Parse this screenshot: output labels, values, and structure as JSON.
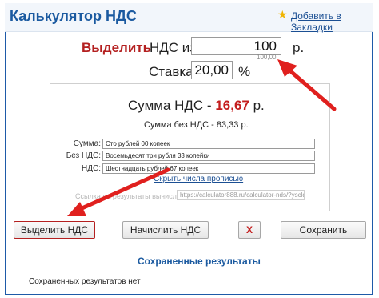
{
  "header": {
    "title": "Калькулятор НДС",
    "bookmark_label": "Добавить в Закладки"
  },
  "form": {
    "mode_label": "Выделить",
    "vat_from_label": "НДС из",
    "amount_value": "100",
    "amount_hint": "100,00",
    "currency_label": "р.",
    "rate_label": "Ставка",
    "rate_value": "20,00",
    "percent_label": "%"
  },
  "result": {
    "vat_prefix": "Сумма НДС - ",
    "vat_value": "16,67",
    "vat_suffix": " р.",
    "net_line": "Сумма без НДС - 83,33 р.",
    "rows": [
      {
        "label": "Сумма:",
        "value": "Сто рублей 00 копеек"
      },
      {
        "label": "Без НДС:",
        "value": "Восемьдесят три рубля 33 копейки"
      },
      {
        "label": "НДС:",
        "value": "Шестнадцать рублей 67 копеек"
      }
    ],
    "hide_words_link": "Скрыть числа прописью",
    "link_label": "Ссылка на результаты вычислений:",
    "link_value": "https://calculator888.ru/calculator-nds/?yscld=c"
  },
  "buttons": {
    "extract_vat": "Выделить НДС",
    "add_vat": "Начислить НДС",
    "clear": "X",
    "save": "Сохранить"
  },
  "saved": {
    "title": "Сохраненные результаты",
    "empty_text": "Сохраненных результатов нет"
  },
  "colors": {
    "accent_red": "#c41e1e",
    "brand_blue": "#1b5aa0",
    "arrow_red": "#e0201e"
  }
}
